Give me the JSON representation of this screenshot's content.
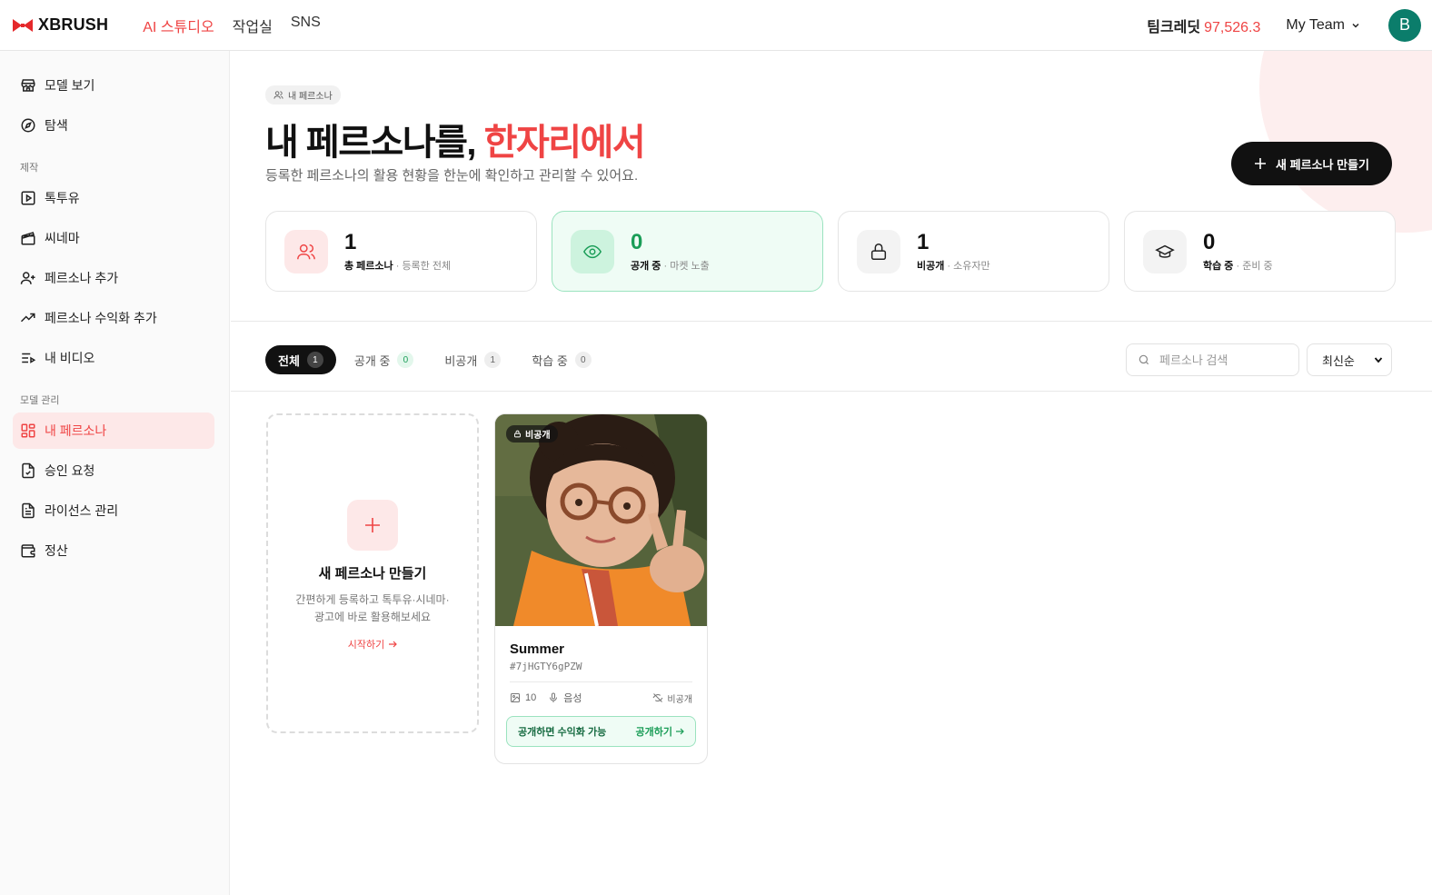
{
  "app": {
    "name": "XBRUSH"
  },
  "topnav": [
    {
      "label": "AI 스튜디오",
      "active": true
    },
    {
      "label": "작업실",
      "active": false
    },
    {
      "label": "SNS",
      "active": false
    }
  ],
  "credit": {
    "label": "팀크레딧",
    "value": "97,526.3"
  },
  "team": {
    "label": "My Team"
  },
  "avatar": {
    "initial": "B"
  },
  "sidebar": {
    "top_items": [
      {
        "label": "모델 보기",
        "icon": "store-icon"
      },
      {
        "label": "탐색",
        "icon": "compass-icon"
      }
    ],
    "section_make": "제작",
    "make_items": [
      {
        "label": "톡투유",
        "icon": "play-square-icon"
      },
      {
        "label": "씨네마",
        "icon": "clapperboard-icon"
      },
      {
        "label": "페르소나 추가",
        "icon": "user-plus-icon"
      },
      {
        "label": "페르소나 수익화 추가",
        "icon": "trending-up-icon"
      },
      {
        "label": "내 비디오",
        "icon": "list-video-icon"
      }
    ],
    "section_manage": "모델 관리",
    "manage_items": [
      {
        "label": "내 페르소나",
        "icon": "layout-grid-icon",
        "active": true
      },
      {
        "label": "승인 요청",
        "icon": "file-check-icon"
      },
      {
        "label": "라이선스 관리",
        "icon": "file-text-icon"
      },
      {
        "label": "정산",
        "icon": "wallet-icon"
      }
    ]
  },
  "hero": {
    "pill": "내 페르소나",
    "title_main": "내 페르소나를, ",
    "title_accent": "한자리에서",
    "subtitle": "등록한 페르소나의 활용 현황을 한눈에 확인하고 관리할 수 있어요.",
    "new_button": "새 페르소나 만들기"
  },
  "stats": [
    {
      "value": "1",
      "label": "총 페르소나",
      "desc": "등록한 전체",
      "icon": "users-icon"
    },
    {
      "value": "0",
      "label": "공개 중",
      "desc": "마켓 노출",
      "icon": "eye-icon"
    },
    {
      "value": "1",
      "label": "비공개",
      "desc": "소유자만",
      "icon": "lock-icon"
    },
    {
      "value": "0",
      "label": "학습 중",
      "desc": "준비 중",
      "icon": "graduation-cap-icon"
    }
  ],
  "tabs": [
    {
      "label": "전체",
      "count": "1",
      "active": true
    },
    {
      "label": "공개 중",
      "count": "0"
    },
    {
      "label": "비공개",
      "count": "1"
    },
    {
      "label": "학습 중",
      "count": "0"
    }
  ],
  "search": {
    "placeholder": "페르소나 검색"
  },
  "sort": {
    "selected": "최신순"
  },
  "new_card": {
    "title": "새 페르소나 만들기",
    "desc": "간편하게 등록하고 톡투유·시네마·광고에 바로 활용해보세요",
    "start": "시작하기"
  },
  "persona": {
    "badge": "비공개",
    "name": "Summer",
    "id": "#7jHGTY6gPZW",
    "images": "10",
    "voice": "음성",
    "visibility": "비공개",
    "cta_text": "공개하면 수익화 가능",
    "cta_action": "공개하기"
  },
  "colors": {
    "accent": "#ef4444",
    "green": "#1a9d57",
    "dark": "#111111"
  }
}
